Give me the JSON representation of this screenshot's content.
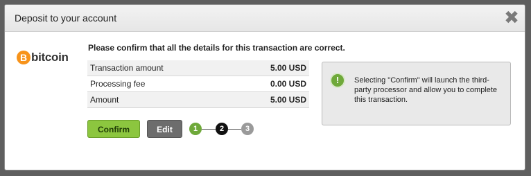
{
  "dialog": {
    "title": "Deposit to your account",
    "close_glyph": "✖"
  },
  "logo": {
    "coin_letter": "B",
    "text": "bitcoin",
    "coin_color": "#f7931a"
  },
  "confirm": {
    "heading": "Please confirm that all the details for this transaction are correct.",
    "rows": [
      {
        "label": "Transaction amount",
        "value": "5.00 USD"
      },
      {
        "label": "Processing fee",
        "value": "0.00 USD"
      },
      {
        "label": "Amount",
        "value": "5.00 USD"
      }
    ],
    "confirm_label": "Confirm",
    "edit_label": "Edit"
  },
  "steps": {
    "items": [
      "1",
      "2",
      "3"
    ],
    "current": 2
  },
  "notice": {
    "icon": "!",
    "text": "Selecting \"Confirm\" will launch the third-party processor and allow you to complete this transaction."
  },
  "colors": {
    "accent_green": "#8cc63f",
    "edit_gray": "#6d6d6d",
    "overlay": "#5f5f5f"
  }
}
